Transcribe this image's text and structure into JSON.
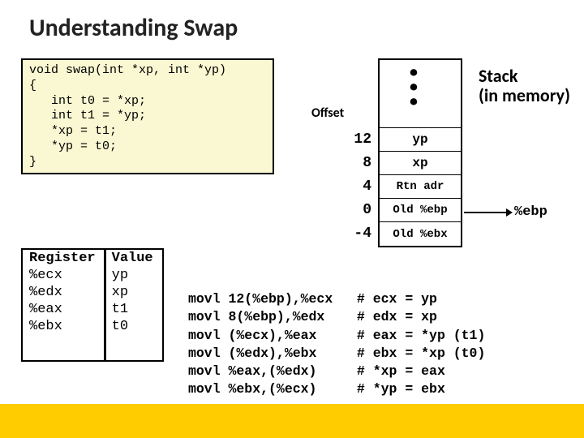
{
  "title": "Understanding Swap",
  "code": "void swap(int *xp, int *yp)\n{\n   int t0 = *xp;\n   int t1 = *yp;\n   *xp = t1;\n   *yp = t0;\n}",
  "stack_label_1": "Stack",
  "stack_label_2": "(in memory)",
  "offset_label": "Offset",
  "offsets": {
    "r3": "12",
    "r4": "8",
    "r5": "4",
    "r6": "0",
    "r7": "-4"
  },
  "stack": {
    "r3": "yp",
    "r4": "xp",
    "r5": "Rtn adr",
    "r6": "Old %ebp",
    "r7": "Old %ebx"
  },
  "ebp": "%ebp",
  "reg_hdr_1": "Register",
  "reg_hdr_2": "Value",
  "regs": {
    "r0a": "%ecx",
    "r0b": "yp",
    "r1a": "%edx",
    "r1b": "xp",
    "r2a": "%eax",
    "r2b": "t1",
    "r3a": "%ebx",
    "r3b": "t0"
  },
  "asm": "movl 12(%ebp),%ecx   # ecx = yp\nmovl 8(%ebp),%edx    # edx = xp\nmovl (%ecx),%eax     # eax = *yp (t1)\nmovl (%edx),%ebx     # ebx = *xp (t0)\nmovl %eax,(%edx)     # *xp = eax\nmovl %ebx,(%ecx)     # *yp = ebx"
}
